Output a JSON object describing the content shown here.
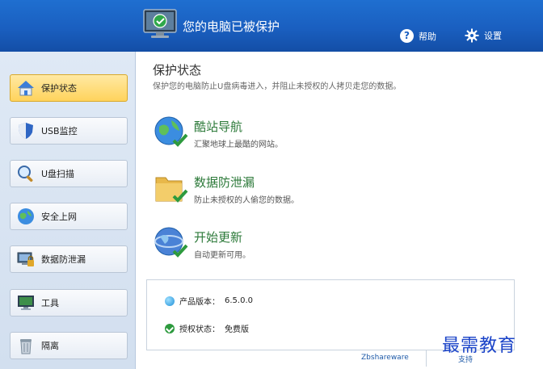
{
  "header": {
    "title": "您的电脑已被保护",
    "help_label": "帮助",
    "settings_label": "设置"
  },
  "sidebar": {
    "items": [
      {
        "label": "保护状态",
        "icon": "home-shield-icon",
        "active": true
      },
      {
        "label": "USB监控",
        "icon": "shield-icon",
        "active": false
      },
      {
        "label": "U盘扫描",
        "icon": "magnifier-icon",
        "active": false
      },
      {
        "label": "安全上网",
        "icon": "globe-icon",
        "active": false
      },
      {
        "label": "数据防泄漏",
        "icon": "computer-lock-icon",
        "active": false
      },
      {
        "label": "工具",
        "icon": "monitor-tools-icon",
        "active": false
      },
      {
        "label": "隔离",
        "icon": "trash-bin-icon",
        "active": false
      }
    ]
  },
  "main": {
    "title": "保护状态",
    "description": "保护您的电脑防止U盘病毒进入，并阻止未授权的人拷贝走您的数据。",
    "features": [
      {
        "title": "酷站导航",
        "desc": "汇聚地球上最酷的网站。",
        "icon": "globe-check-icon"
      },
      {
        "title": "数据防泄漏",
        "desc": "防止未授权的人偷您的数据。",
        "icon": "folder-check-icon"
      },
      {
        "title": "开始更新",
        "desc": "自动更新可用。",
        "icon": "globe-update-icon"
      }
    ],
    "info": {
      "version_label": "产品版本：",
      "version_value": "6.5.0.0",
      "license_label": "授权状态：",
      "license_value": "免费版"
    },
    "footer": {
      "link_left": "Zbshareware",
      "link_right": "支持"
    }
  },
  "watermark": "最需教育",
  "colors": {
    "header_blue": "#1a5fc0",
    "active_yellow": "#ffd35c",
    "feature_green": "#2d7a3a",
    "watermark_blue": "#1a43c8"
  }
}
